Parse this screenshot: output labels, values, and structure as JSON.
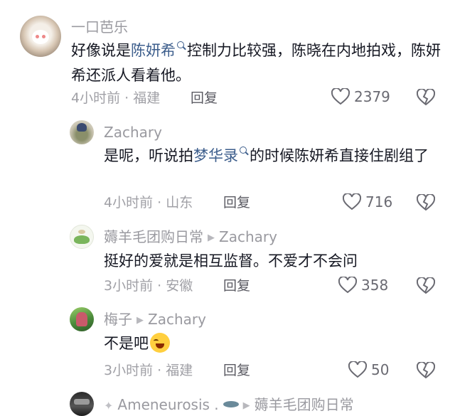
{
  "comments": [
    {
      "username": "一口芭乐",
      "text_parts": [
        "好像说是",
        "陈妍希",
        "控制力比较强，陈晓在内地拍戏，陈妍希还派人看着他。"
      ],
      "time": "4小时前 · 福建",
      "reply_label": "回复",
      "likes": "2379"
    },
    {
      "username": "Zachary",
      "text_parts": [
        "是呢，听说拍",
        "梦华录",
        "的时候陈妍希直接住剧组了"
      ],
      "time": "4小时前 · 山东",
      "reply_label": "回复",
      "likes": "716"
    },
    {
      "username": "薅羊毛团购日常",
      "reply_to": "Zachary",
      "text": "挺好的爱就是相互监督。不爱才不会问",
      "time": "3小时前 · 安徽",
      "reply_label": "回复",
      "likes": "358"
    },
    {
      "username": "梅子",
      "reply_to": "Zachary",
      "text": "不是吧",
      "time": "3小时前 · 福建",
      "reply_label": "回复",
      "likes": "50"
    },
    {
      "username": "Ameneurosis .",
      "reply_to": "薅羊毛团购日常"
    }
  ],
  "icons": {
    "like": "heart-outline-icon",
    "dislike": "broken-heart-icon",
    "reply_arrow": "triangle-right-icon",
    "link": "search-link-icon"
  },
  "colors": {
    "link": "#3d5e8c",
    "meta": "#a0a0a6",
    "text": "#161823"
  }
}
